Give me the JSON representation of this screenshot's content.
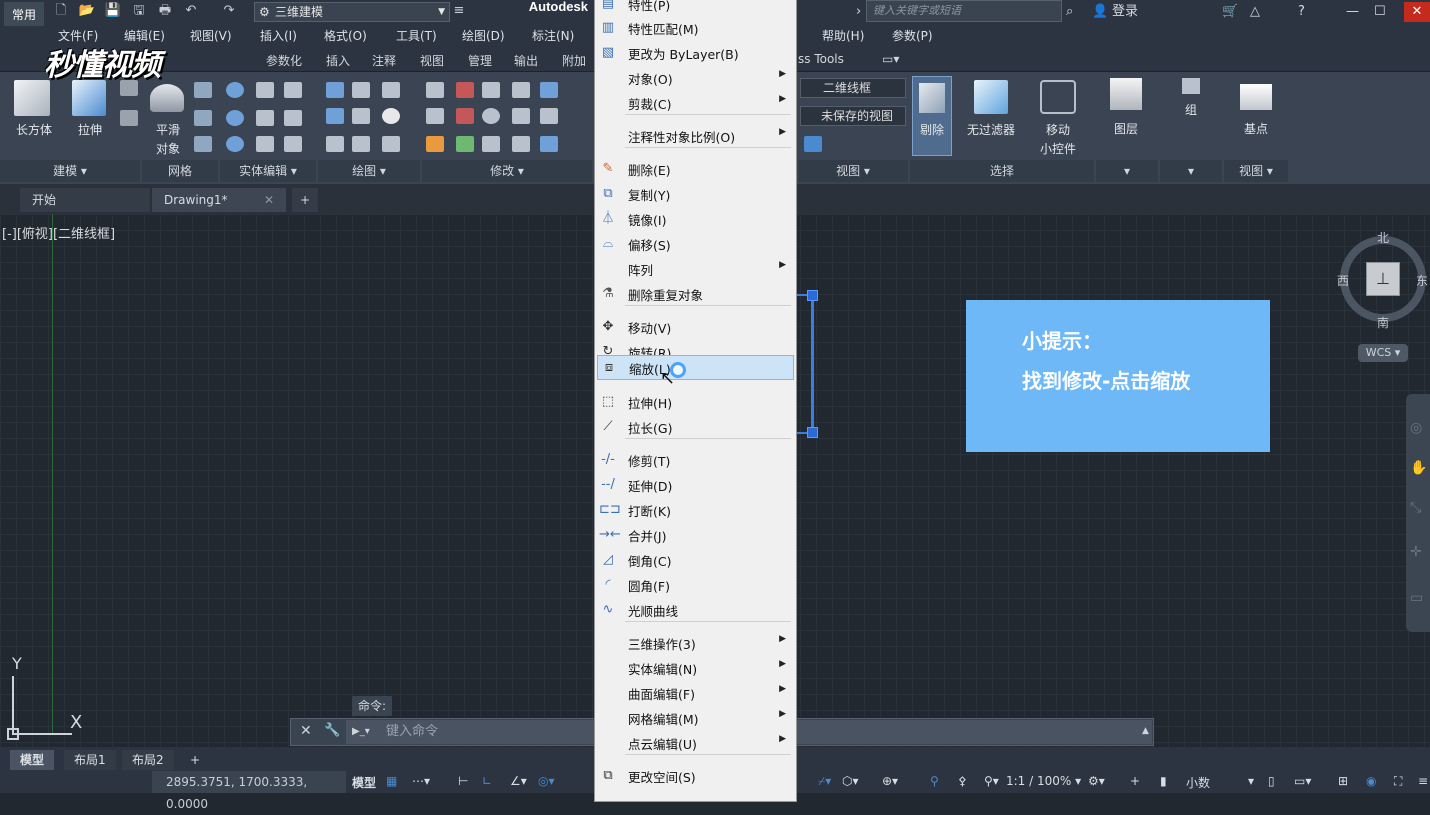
{
  "title_bar": {
    "workspace_select": "三维建模",
    "app_title": "Autodesk",
    "search_placeholder": "键入关键字或短语",
    "login_label": "登录"
  },
  "menubar": {
    "items": [
      "文件(F)",
      "编辑(E)",
      "视图(V)",
      "插入(I)",
      "格式(O)",
      "工具(T)",
      "绘图(D)",
      "标注(N)",
      "帮助(H)",
      "参数(P)"
    ]
  },
  "ribbon_tabs": {
    "active": "常用",
    "items": [
      "参数化",
      "插入",
      "注释",
      "视图",
      "管理",
      "输出",
      "附加"
    ],
    "extra": "ss Tools"
  },
  "ribbon": {
    "buttons": {
      "box": "长方体",
      "extrude": "拉伸",
      "smooth_line1": "平滑",
      "smooth_line2": "对象",
      "cull": "剔除",
      "no_filter": "无过滤器",
      "move_gizmo_line1": "移动",
      "move_gizmo_line2": "小控件",
      "layers": "图层",
      "group": "组",
      "base_point": "基点"
    },
    "visual_style_select": "二维线框",
    "view_select": "未保存的视图",
    "panels": [
      "建模",
      "网格",
      "实体编辑",
      "绘图",
      "修改",
      "视图",
      "选择",
      "视图"
    ]
  },
  "file_tabs": {
    "start": "开始",
    "drawing": "Drawing1*",
    "add": "+"
  },
  "viewport": {
    "label": "[-][俯视][二维线框]"
  },
  "context_menu": {
    "items": [
      {
        "label": "特性(P)"
      },
      {
        "label": "特性匹配(M)"
      },
      {
        "label": "更改为 ByLayer(B)"
      },
      {
        "label": "对象(O)",
        "submenu": true
      },
      {
        "label": "剪裁(C)",
        "submenu": true
      },
      {
        "label": "注释性对象比例(O)",
        "submenu": true
      },
      {
        "label": "删除(E)"
      },
      {
        "label": "复制(Y)"
      },
      {
        "label": "镜像(I)"
      },
      {
        "label": "偏移(S)"
      },
      {
        "label": "阵列",
        "submenu": true
      },
      {
        "label": "删除重复对象"
      },
      {
        "label": "移动(V)"
      },
      {
        "label": "旋转(R)"
      },
      {
        "label": "缩放(L)",
        "highlighted": true
      },
      {
        "label": "拉伸(H)"
      },
      {
        "label": "拉长(G)"
      },
      {
        "label": "修剪(T)"
      },
      {
        "label": "延伸(D)"
      },
      {
        "label": "打断(K)"
      },
      {
        "label": "合并(J)"
      },
      {
        "label": "倒角(C)"
      },
      {
        "label": "圆角(F)"
      },
      {
        "label": "光顺曲线"
      },
      {
        "label": "三维操作(3)",
        "submenu": true
      },
      {
        "label": "实体编辑(N)",
        "submenu": true
      },
      {
        "label": "曲面编辑(F)",
        "submenu": true
      },
      {
        "label": "网格编辑(M)",
        "submenu": true
      },
      {
        "label": "点云编辑(U)",
        "submenu": true
      },
      {
        "label": "更改空间(S)"
      }
    ]
  },
  "tip": {
    "title": "小提示：",
    "text": "找到修改-点击缩放"
  },
  "viewcube": {
    "north": "北",
    "south": "南",
    "east": "东",
    "west": "西",
    "wcs": "WCS"
  },
  "ucs": {
    "x": "X",
    "y": "Y"
  },
  "command": {
    "history_label": "命令:",
    "placeholder": "键入命令"
  },
  "layout_tabs": [
    "模型",
    "布局1",
    "布局2",
    "+"
  ],
  "statusbar": {
    "coords": "2895.3751, 1700.3333, 0.0000",
    "model": "模型",
    "scale": "1:1 / 100%",
    "decimal": "小数"
  },
  "watermark": "秒懂视频",
  "colors": {
    "tip_bg": "#6fb8f8",
    "selection": "#2a6bd8",
    "highlight": "#cde4f7"
  }
}
